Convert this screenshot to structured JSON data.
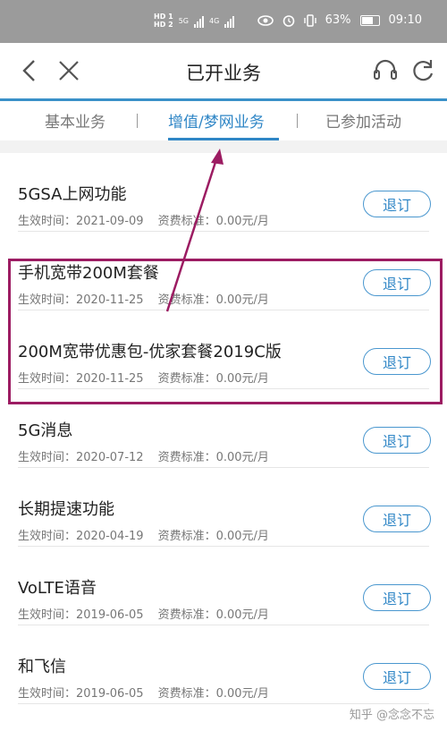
{
  "status_bar": {
    "hd1": "HD 1",
    "hd2": "HD 2",
    "net1": "5G",
    "net2": "4G",
    "battery_pct": "63%",
    "time": "09:10"
  },
  "header": {
    "title": "已开业务"
  },
  "tabs": [
    {
      "label": "基本业务",
      "active": false
    },
    {
      "label": "增值/梦网业务",
      "active": true
    },
    {
      "label": "已参加活动",
      "active": false
    }
  ],
  "meta_labels": {
    "effective": "生效时间：",
    "fee": "资费标准："
  },
  "items": [
    {
      "name": "5GSA上网功能",
      "date": "2021-09-09",
      "fee": "0.00元/月",
      "button": "退订"
    },
    {
      "name": "手机宽带200M套餐",
      "date": "2020-11-25",
      "fee": "0.00元/月",
      "button": "退订"
    },
    {
      "name": "200M宽带优惠包-优家套餐2019C版",
      "date": "2020-11-25",
      "fee": "0.00元/月",
      "button": "退订"
    },
    {
      "name": "5G消息",
      "date": "2020-07-12",
      "fee": "0.00元/月",
      "button": "退订"
    },
    {
      "name": "长期提速功能",
      "date": "2020-04-19",
      "fee": "0.00元/月",
      "button": "退订"
    },
    {
      "name": "VoLTE语音",
      "date": "2019-06-05",
      "fee": "0.00元/月",
      "button": "退订"
    },
    {
      "name": "和飞信",
      "date": "2019-06-05",
      "fee": "0.00元/月",
      "button": "退订"
    }
  ],
  "watermark": "知乎 @念念不忘",
  "colors": {
    "accent": "#2f86c6",
    "highlight": "#9c1c62",
    "status_bar": "#9b9b9b"
  },
  "icons": [
    "back-icon",
    "close-icon",
    "headset-icon",
    "refresh-icon",
    "eye-icon",
    "alarm-icon",
    "vibrate-icon",
    "battery-icon",
    "signal-icon"
  ]
}
